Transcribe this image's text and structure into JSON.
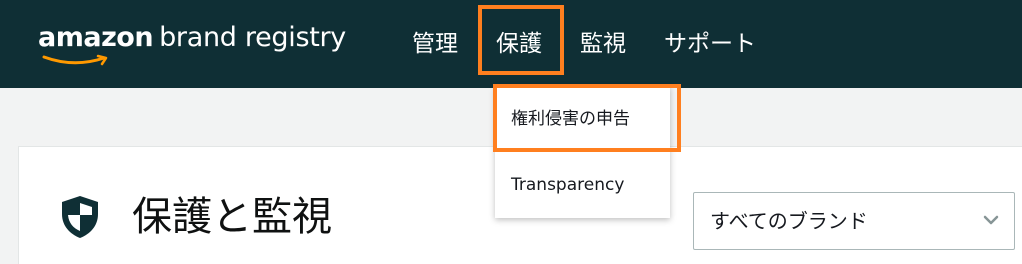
{
  "colors": {
    "header_bg": "#0f2f35",
    "highlight": "#ff7f1f",
    "page_bg": "#f2f3f3",
    "card_bg": "#ffffff"
  },
  "header": {
    "logo": {
      "primary": "amazon",
      "secondary": "brand registry"
    },
    "nav": [
      {
        "label": "管理"
      },
      {
        "label": "保護"
      },
      {
        "label": "監視"
      },
      {
        "label": "サポート"
      }
    ]
  },
  "dropdown": {
    "items": [
      {
        "label": "権利侵害の申告"
      },
      {
        "label": "Transparency"
      }
    ]
  },
  "main": {
    "title": "保護と監視",
    "icon": "shield-icon",
    "brand_select": {
      "value": "すべてのブランド",
      "icon": "chevron-down-icon"
    }
  }
}
